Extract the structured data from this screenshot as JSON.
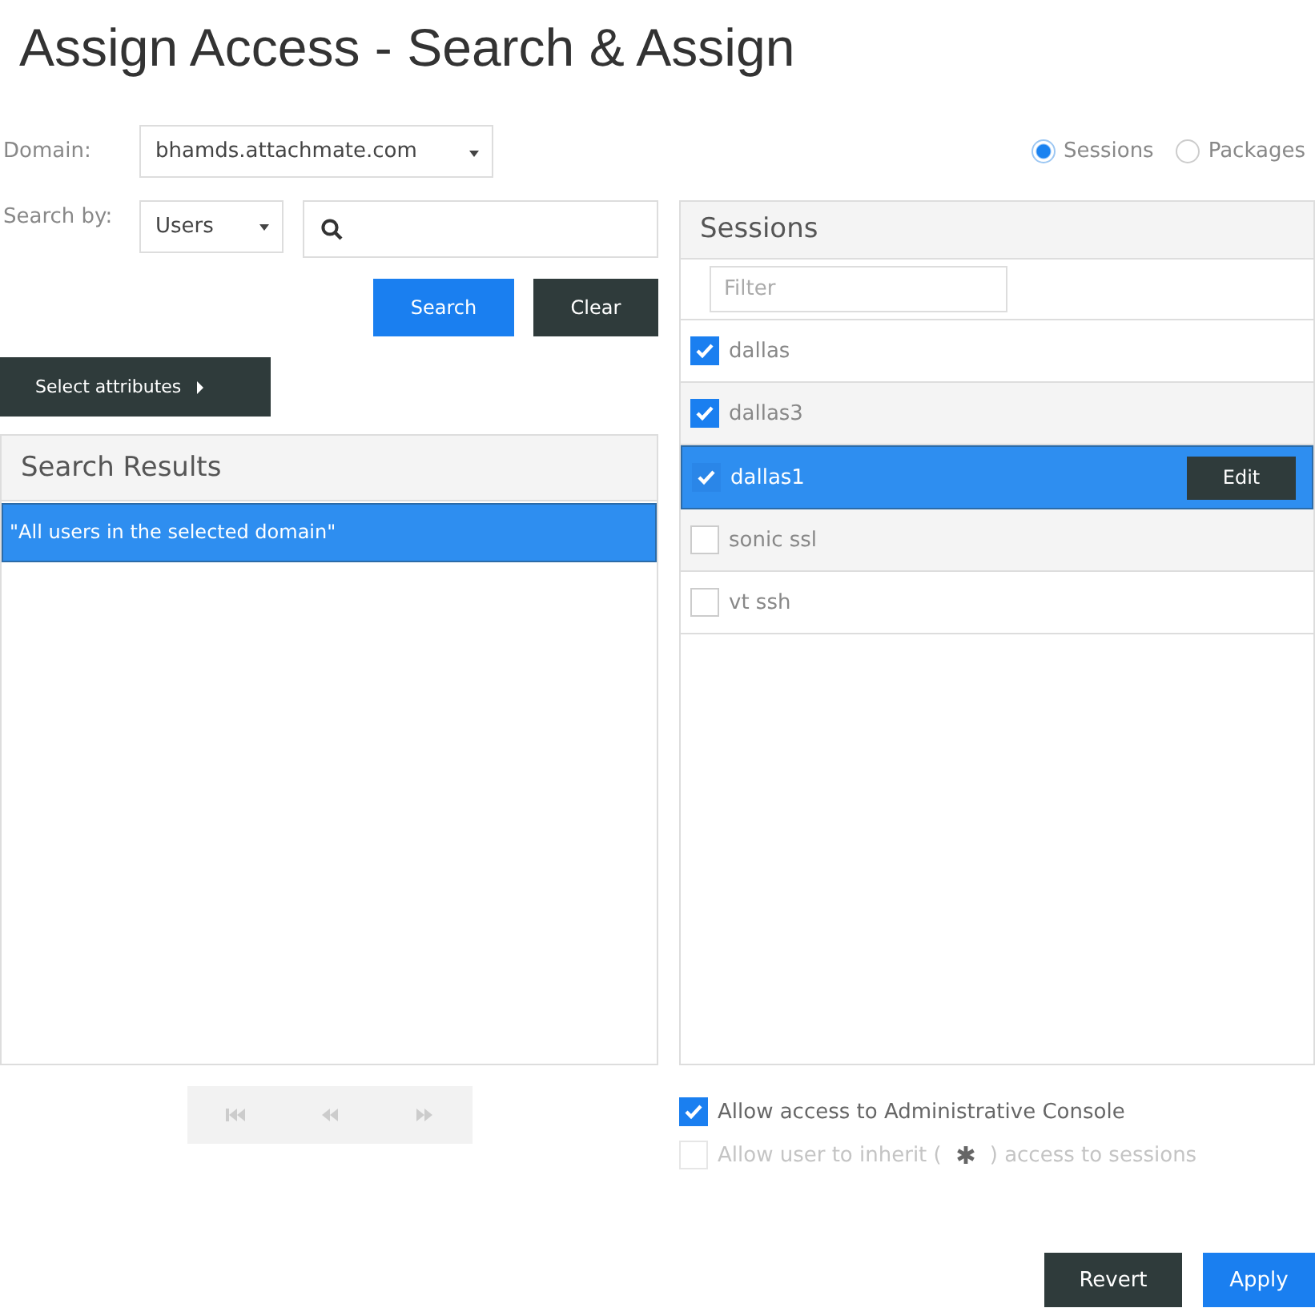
{
  "title": "Assign Access - Search & Assign",
  "domain": {
    "label": "Domain:",
    "value": "bhamds.attachmate.com"
  },
  "view_options": [
    {
      "label": "Sessions",
      "selected": true
    },
    {
      "label": "Packages",
      "selected": false
    }
  ],
  "search": {
    "label": "Search by:",
    "type_value": "Users"
  },
  "search_buttons": [
    "Search",
    "Clear"
  ],
  "attributes_button": "Select attributes",
  "search_results": {
    "title": "Search Results",
    "rows": [
      {
        "text": "\"All users in the selected domain\"",
        "selected": true
      }
    ]
  },
  "pager": [
    {
      "kind": "first",
      "disabled": true
    },
    {
      "kind": "prev",
      "disabled": true
    },
    {
      "kind": "next",
      "disabled": true
    }
  ],
  "sessions": {
    "title": "Sessions",
    "filter_placeholder": "Filter",
    "rows": [
      {
        "name": "dallas",
        "checked": true,
        "selected": false
      },
      {
        "name": "dallas3",
        "checked": true,
        "selected": false
      },
      {
        "name": "dallas1",
        "checked": true,
        "selected": true,
        "action": "Edit"
      },
      {
        "name": "sonic ssl",
        "checked": false,
        "selected": false
      },
      {
        "name": "vt ssh",
        "checked": false,
        "selected": false
      }
    ]
  },
  "options": [
    {
      "label": "Allow access to Administrative Console",
      "checked": true,
      "disabled": false
    },
    {
      "label": "Allow user to inherit (",
      "label_after": ") access to sessions",
      "checked": false,
      "disabled": true
    }
  ],
  "footer_buttons": [
    {
      "label": "Revert",
      "kind": "secondary"
    },
    {
      "label": "Apply",
      "kind": "primary"
    }
  ]
}
